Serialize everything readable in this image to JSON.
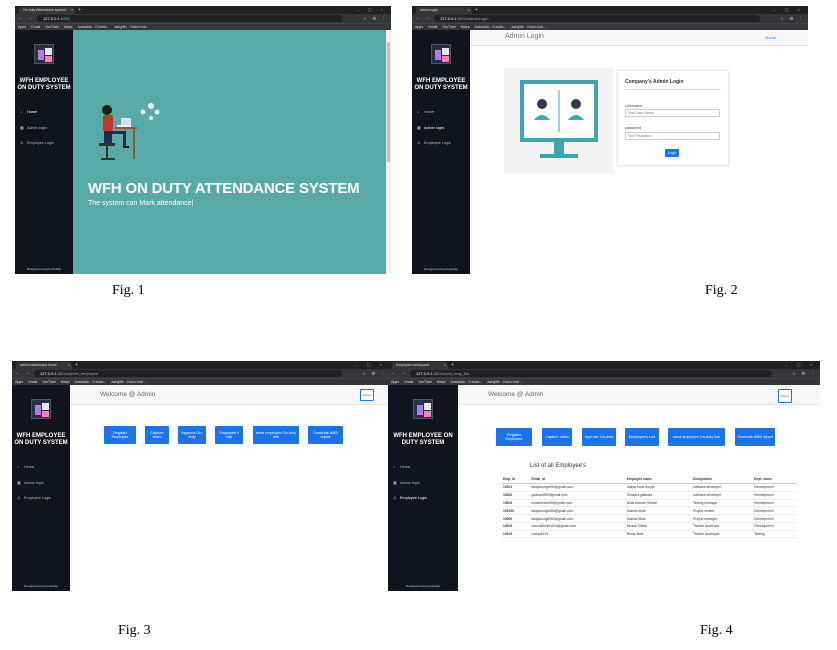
{
  "captions": [
    "Fig. 1",
    "Fig. 2",
    "Fig. 3",
    "Fig. 4"
  ],
  "browser": {
    "bookmarks": [
      "Apps",
      "Gmail",
      "YouTube",
      "Maps",
      "Autodesk - Creatio...",
      "aangilth - Yahoo Inst..."
    ]
  },
  "sidebar": {
    "title": "WFH EMPLOYEE ON DUTY SYSTEM",
    "items": [
      "Home",
      "Admin login",
      "Employee Login"
    ],
    "footer": "Designed using bootstrap"
  },
  "fig1": {
    "tab_title": "On duty Attendance system",
    "url_host": "127.0.0.1",
    "url_path": ":8000",
    "hero_title": "WFH ON DUTY ATTENDANCE SYSTEM",
    "hero_sub": "The system can Mark attendance|"
  },
  "fig2": {
    "tab_title": "admin login",
    "url_host": "127.0.0.1",
    "url_path": ":8000/adminLogin",
    "page_title": "Admin Login",
    "home_link": "Home",
    "card_title": "Company's Admin Login",
    "username_label": "Username",
    "username_placeholder": "Your User Name",
    "password_label": "password",
    "password_placeholder": "Your Password",
    "login_button": "Login"
  },
  "fig3": {
    "tab_title": "admin dashboard home",
    "url_host": "127.0.0.1",
    "url_path": ":8000/admin_employee",
    "welcome": "Welcome @ Admin",
    "logout": "logout",
    "buttons": [
      "Register Employee",
      "Capture video",
      "Approve On-duty",
      "Employee's List",
      "send employee On-duty link",
      "Generate AMS report"
    ]
  },
  "fig4": {
    "tab_title": "Employee workspace",
    "url_host": "127.0.0.1",
    "url_path": ":8000/read_emp_list",
    "welcome": "Welcome @ Admin",
    "logout": "logout",
    "buttons": [
      "Register Employee",
      "Capture video",
      "Approve On-duty",
      "Employee's List",
      "send employee On-duty link",
      "Generate AMS report"
    ],
    "list_title": "List of all Employee's",
    "columns": [
      "Emp_id",
      "Email_id",
      "Employee name",
      "Designation",
      "Dept_name"
    ],
    "rows": [
      [
        "10001",
        "adityasunge590@gmail.com",
        "Aditya Sunil Sunge",
        "software developer",
        "Development"
      ],
      [
        "10002",
        "gaikwad905@gmail.com",
        "Shradha gaikwad",
        "software developer",
        "Development"
      ],
      [
        "10004",
        "nihalshinde850@gmail.com",
        "Nihal Ankush Shinde",
        "Testing manager",
        "Development"
      ],
      [
        "102330",
        "adityasunge584@gmail.com",
        "Salman khan",
        "Project vender",
        "Development"
      ],
      [
        "10009",
        "adityasunge984@gmail.com",
        "Salman Bhai",
        "Project manager",
        "Development"
      ],
      [
        "10003",
        "mrunalshirke1818@gmail.com",
        "Mrunal Shirke",
        "Trainee developer",
        "Development"
      ],
      [
        "10015",
        "rocky@123",
        "Rocky Bahi",
        "Trainee developer",
        "Testing"
      ]
    ]
  }
}
